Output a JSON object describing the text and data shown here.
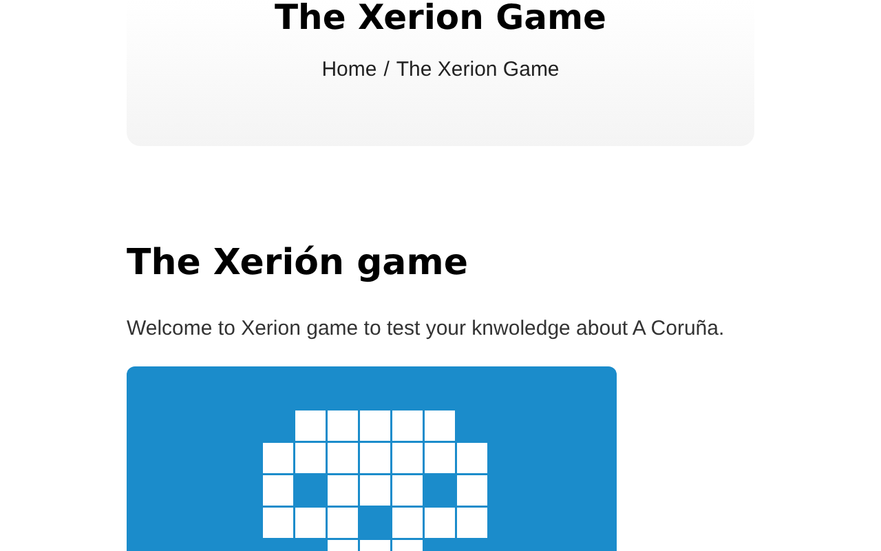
{
  "header": {
    "title": "The Xerion Game",
    "breadcrumb": [
      {
        "label": "Home",
        "separator": "/"
      },
      {
        "label": "The Xerion Game"
      }
    ]
  },
  "content": {
    "heading": "The Xerión game",
    "intro": "Welcome to Xerion game to test your knwoledge about A Coruña."
  }
}
